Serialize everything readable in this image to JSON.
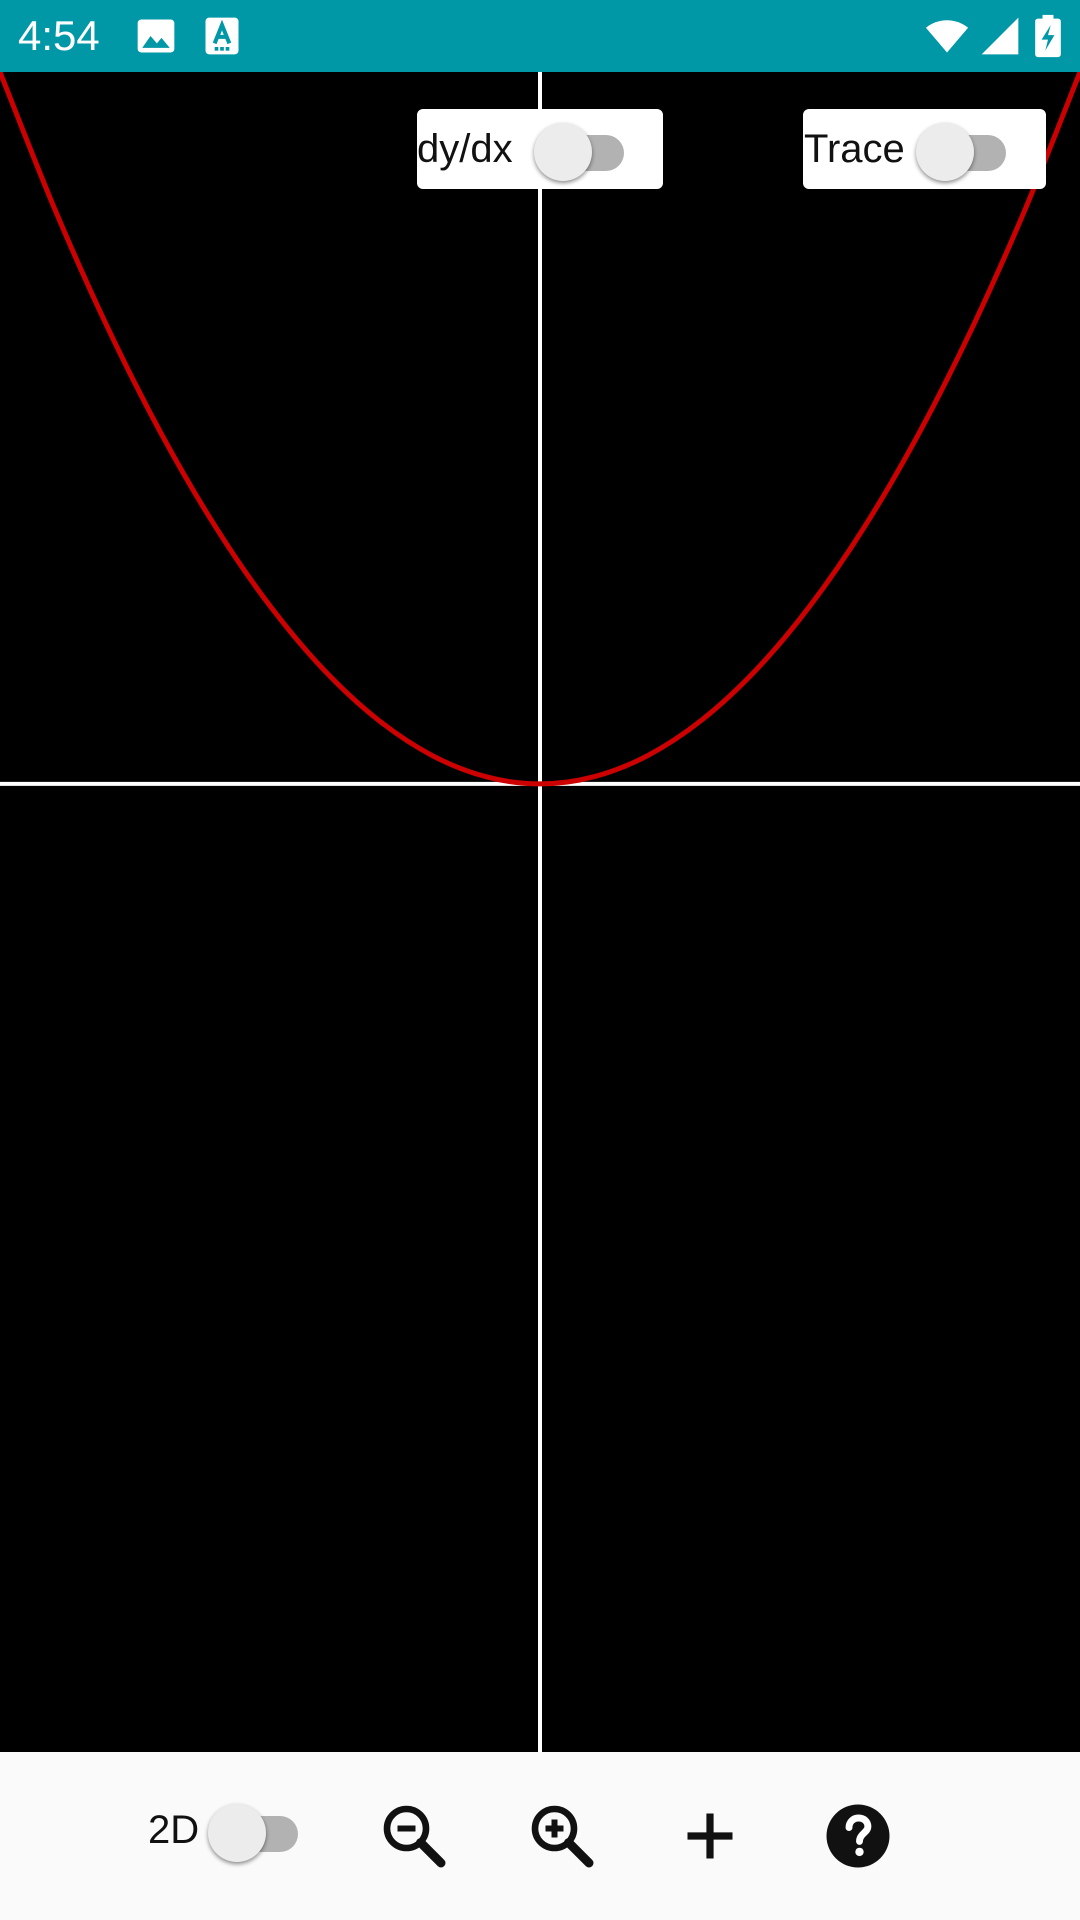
{
  "status_bar": {
    "time": "4:54",
    "background": "#0097A7",
    "icons": [
      "image-icon",
      "text-recognition-icon",
      "wifi-icon",
      "cell-signal-icon",
      "battery-charging-icon"
    ]
  },
  "graph": {
    "background": "#000000",
    "axis_color": "#FFFFFF",
    "curve_color": "#CC0000"
  },
  "chart_data": {
    "type": "line",
    "title": "",
    "xlabel": "",
    "ylabel": "",
    "grid": false,
    "xlim": [
      -1.0,
      1.0
    ],
    "ylim": [
      -1.36,
      1.0
    ],
    "series": [
      {
        "name": "",
        "x": [
          -1,
          -0.9,
          -0.8,
          -0.7,
          -0.6,
          -0.5,
          -0.4,
          -0.3,
          -0.2,
          -0.1,
          0,
          0.1,
          0.2,
          0.3,
          0.4,
          0.5,
          0.6,
          0.7,
          0.8,
          0.9,
          1
        ],
        "y": [
          1,
          0.81,
          0.64,
          0.49,
          0.36,
          0.25,
          0.16,
          0.09,
          0.04,
          0.01,
          0,
          0.01,
          0.04,
          0.09,
          0.16,
          0.25,
          0.36,
          0.49,
          0.64,
          0.81,
          1
        ]
      }
    ]
  },
  "toggles": {
    "derivative": {
      "label": "dy/dx",
      "on": false
    },
    "trace": {
      "label": "Trace",
      "on": false
    }
  },
  "toolbar": {
    "mode_label": "2D",
    "mode_on": false,
    "buttons": [
      "zoom-out-icon",
      "zoom-in-icon",
      "plus-icon",
      "help-icon"
    ]
  }
}
